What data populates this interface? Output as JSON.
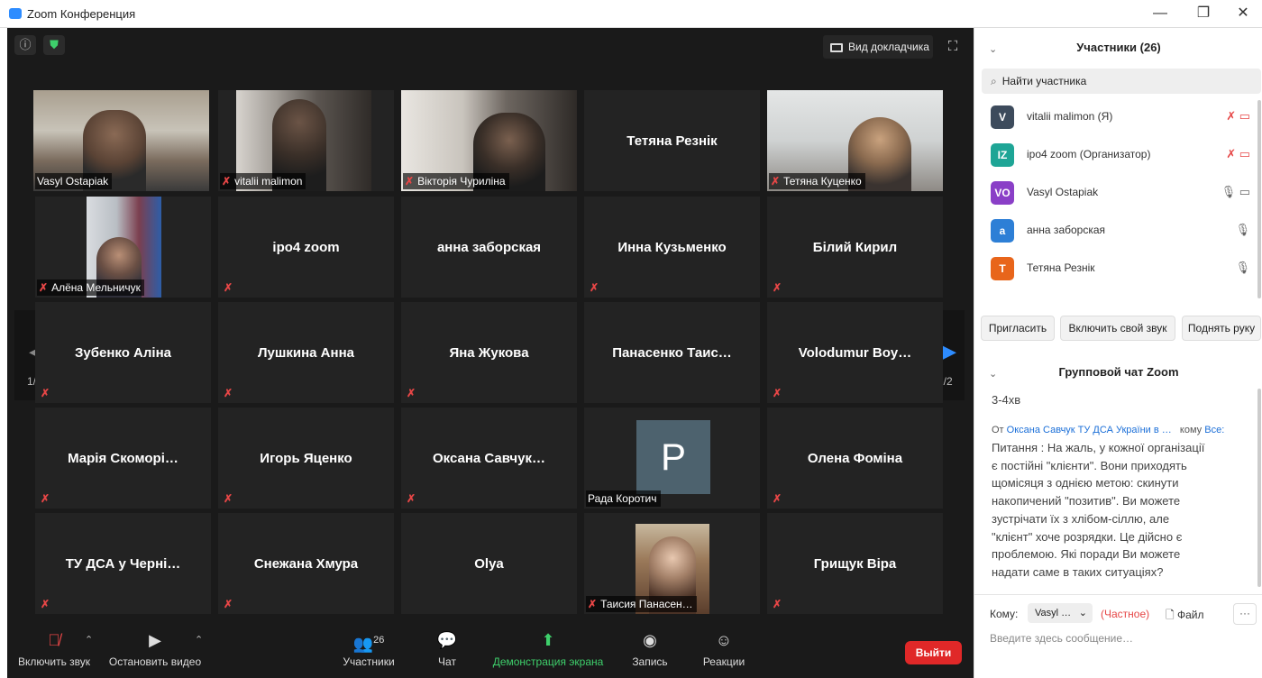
{
  "window": {
    "title": "Zoom Конференция",
    "minimize": "—",
    "restore": "❐",
    "close": "✕"
  },
  "meeting": {
    "speaker_view_label": "Вид докладчика",
    "page_left": "1/2",
    "page_right": "1/2",
    "tiles": [
      {
        "name": "Vasyl Ostapiak",
        "label": "Vasyl Ostapiak",
        "video": true,
        "active": true,
        "muted": false
      },
      {
        "name": "vitalii malimon",
        "label": "vitalii malimon",
        "video": true,
        "muted": true
      },
      {
        "name": "Вікторія Чуриліна",
        "label": "Вікторія Чуриліна",
        "video": true,
        "muted": true
      },
      {
        "name": "Тетяна Резнік",
        "video": false,
        "muted": false
      },
      {
        "name": "Тетяна Куценко",
        "label": "Тетяна Куценко",
        "video": true,
        "muted": true
      },
      {
        "name": "Алёна Мельничук",
        "label": "Алёна Мельничук",
        "video": true,
        "muted": true
      },
      {
        "name": "ipo4 zoom",
        "video": false,
        "muted": true
      },
      {
        "name": "анна заборская",
        "video": false,
        "muted": false
      },
      {
        "name": "Инна Кузьменко",
        "video": false,
        "muted": true
      },
      {
        "name": "Білий Кирил",
        "video": false,
        "muted": true
      },
      {
        "name": "Зубенко Аліна",
        "video": false,
        "muted": true
      },
      {
        "name": "Лушкина Анна",
        "video": false,
        "muted": true
      },
      {
        "name": "Яна Жукова",
        "video": false,
        "muted": true
      },
      {
        "name": "Панасенко  Таис…",
        "video": false,
        "muted": false
      },
      {
        "name": "Volodumur  Boy…",
        "video": false,
        "muted": true
      },
      {
        "name": "Марія  Скоморі…",
        "video": false,
        "muted": true
      },
      {
        "name": "Игорь Яценко",
        "video": false,
        "muted": true
      },
      {
        "name": "Оксана  Савчук…",
        "video": false,
        "muted": true
      },
      {
        "name": "Рада Коротич",
        "label": "Рада Коротич",
        "avatar_letter": "P",
        "video": false,
        "muted": false
      },
      {
        "name": "Олена Фоміна",
        "video": false,
        "muted": true
      },
      {
        "name": "ТУ ДСА у Черні…",
        "video": false,
        "muted": true
      },
      {
        "name": "Снежана Хмура",
        "video": false,
        "muted": true
      },
      {
        "name": "Olya",
        "video": false,
        "muted": false
      },
      {
        "name": "Таисия Панасен…",
        "label": "Таисия Панасен…",
        "video": true,
        "muted": true
      },
      {
        "name": "Грищук Віра",
        "video": false,
        "muted": true
      }
    ]
  },
  "toolbar": {
    "unmute": "Включить звук",
    "stop_video": "Остановить видео",
    "participants": "Участники",
    "participants_count": "26",
    "chat": "Чат",
    "share": "Демонстрация экрана",
    "record": "Запись",
    "reactions": "Реакции",
    "leave": "Выйти"
  },
  "participants_panel": {
    "title": "Участники (26)",
    "search_placeholder": "Найти участника",
    "list": [
      {
        "initials": "V",
        "name": "vitalii malimon (Я)",
        "color": "#3d4b5c"
      },
      {
        "initials": "IZ",
        "name": "ipo4 zoom (Организатор)",
        "color": "#1ea596"
      },
      {
        "initials": "VO",
        "name": "Vasyl Ostapiak",
        "color": "#8a3fc7"
      },
      {
        "initials": "a",
        "name": "анна заборская",
        "color": "#2d7fd6"
      },
      {
        "initials": "T",
        "name": "Тетяна Резнік",
        "color": "#e8651b"
      }
    ],
    "invite": "Пригласить",
    "unmute_me": "Включить свой звук",
    "raise_hand": "Поднять руку"
  },
  "chat": {
    "title": "Групповой чат Zoom",
    "message1": "3-4хв",
    "from_label": "От",
    "from_name": "Оксана Савчук ТУ ДСА України в …",
    "to_label": "кому",
    "to_name": "Все:",
    "message2": "Питання : На жаль, у кожної організації\nє постійні \"клієнти\". Вони приходять\nщомісяця з однією метою: скинути\nнакопичений \"позитив\". Ви можете\nзустрічати їх з хлібом-сіллю, але\n\"клієнт\" хоче розрядки.  Це дійсно є\nпроблемою.   Які поради Ви можете\nнадати саме в таких ситуаціях?",
    "to_prefix": "Кому:",
    "recipient": "Vasyl …",
    "private": "(Частное)",
    "file": "Файл",
    "more": "···",
    "input_placeholder": "Введите здесь сообщение…"
  }
}
